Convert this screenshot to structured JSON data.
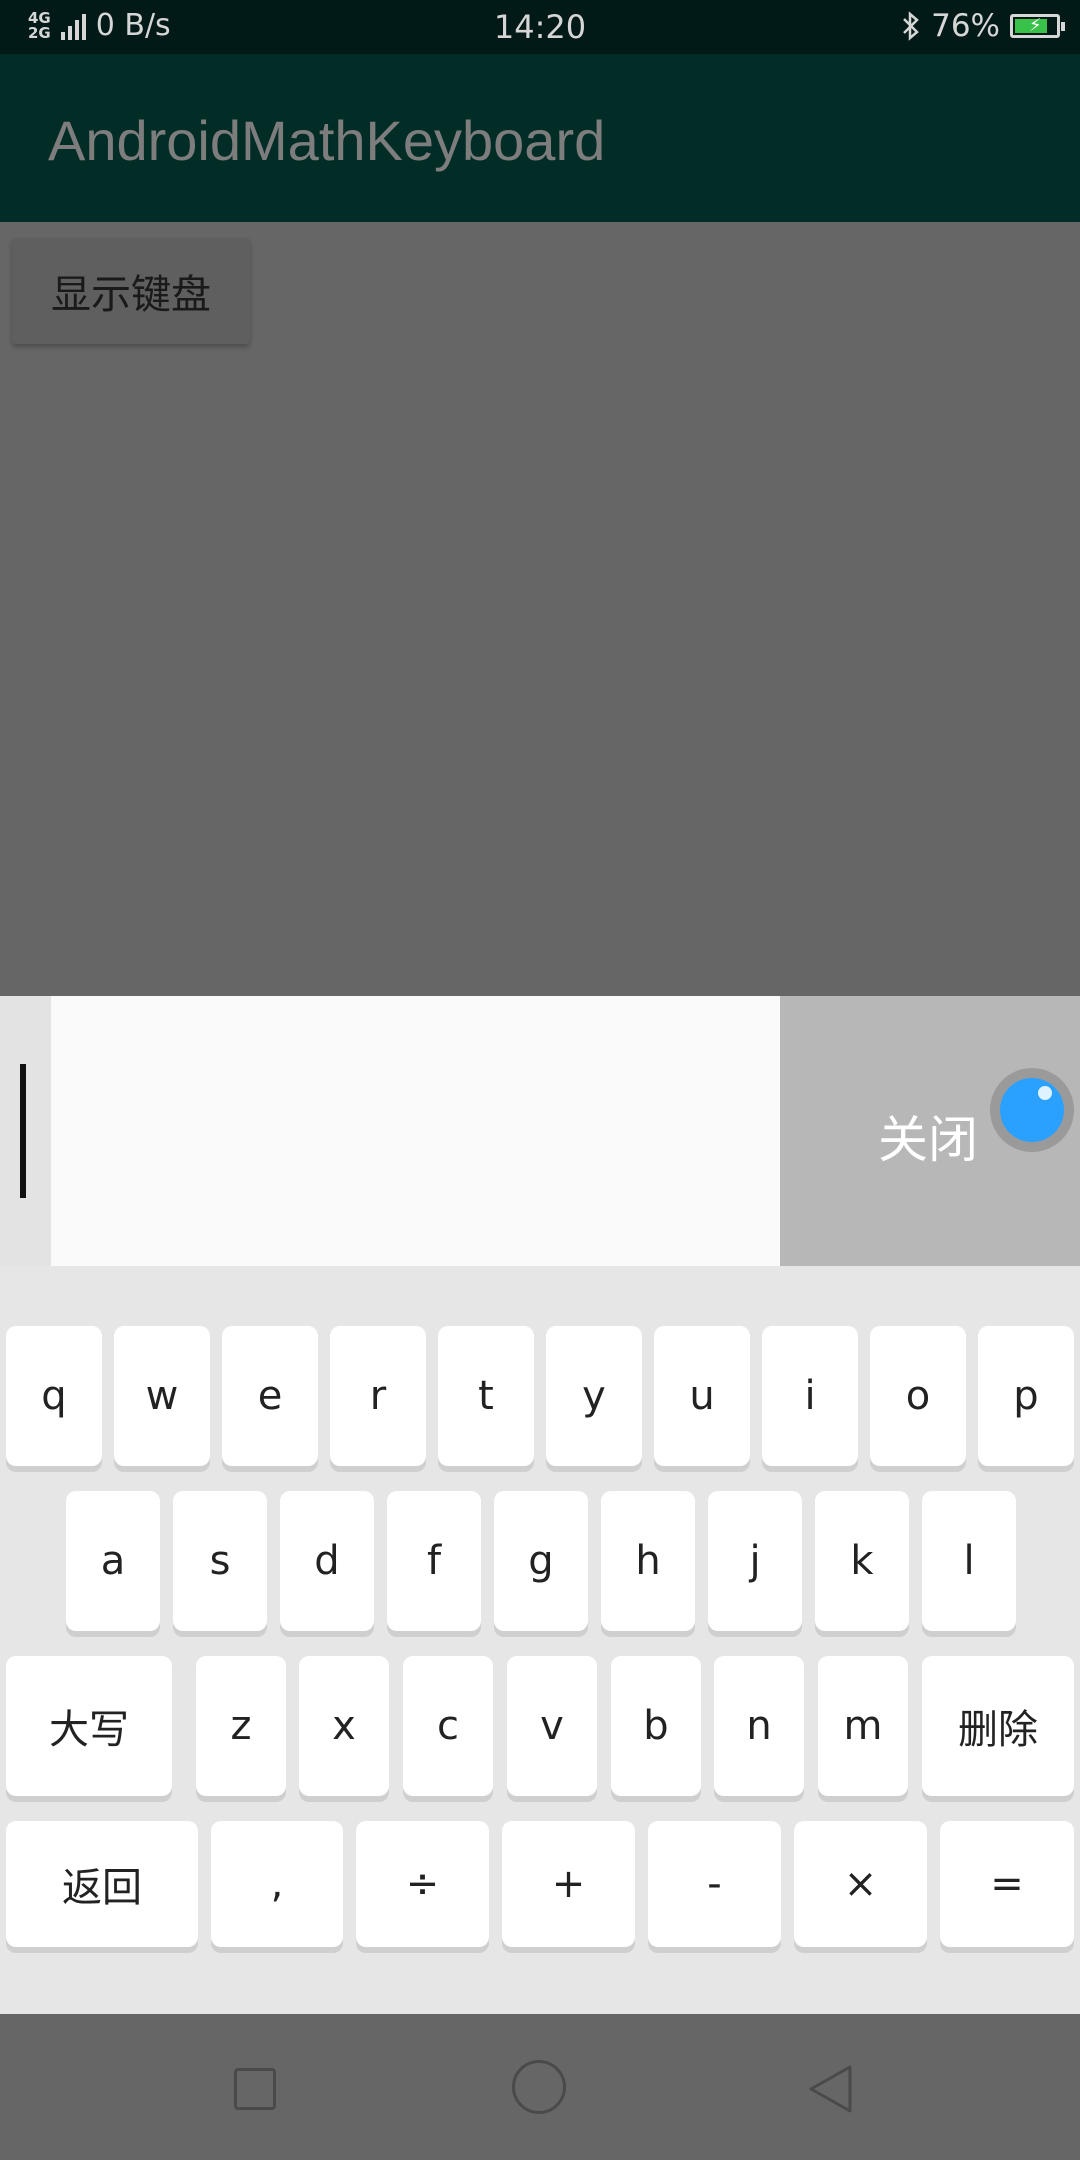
{
  "status_bar": {
    "network_top": "4G",
    "network_bottom": "2G",
    "speed": "0 B/s",
    "time": "14:20",
    "battery": "76%"
  },
  "app_bar": {
    "title": "AndroidMathKeyboard"
  },
  "main": {
    "show_keyboard_label": "显示键盘"
  },
  "input_bar": {
    "close_label": "关闭"
  },
  "keyboard": {
    "row1": [
      "q",
      "w",
      "e",
      "r",
      "t",
      "y",
      "u",
      "i",
      "o",
      "p"
    ],
    "row2": [
      "a",
      "s",
      "d",
      "f",
      "g",
      "h",
      "j",
      "k",
      "l"
    ],
    "row3": [
      "大写",
      "z",
      "x",
      "c",
      "v",
      "b",
      "n",
      "m",
      "删除"
    ],
    "row4": [
      "返回",
      ",",
      "÷",
      "+",
      "-",
      "×",
      "="
    ]
  },
  "colors": {
    "app_bar": "#022d27",
    "status_bar": "#021a17",
    "accent_icon": "#2aa0ff",
    "battery_fill": "#39c24a"
  }
}
